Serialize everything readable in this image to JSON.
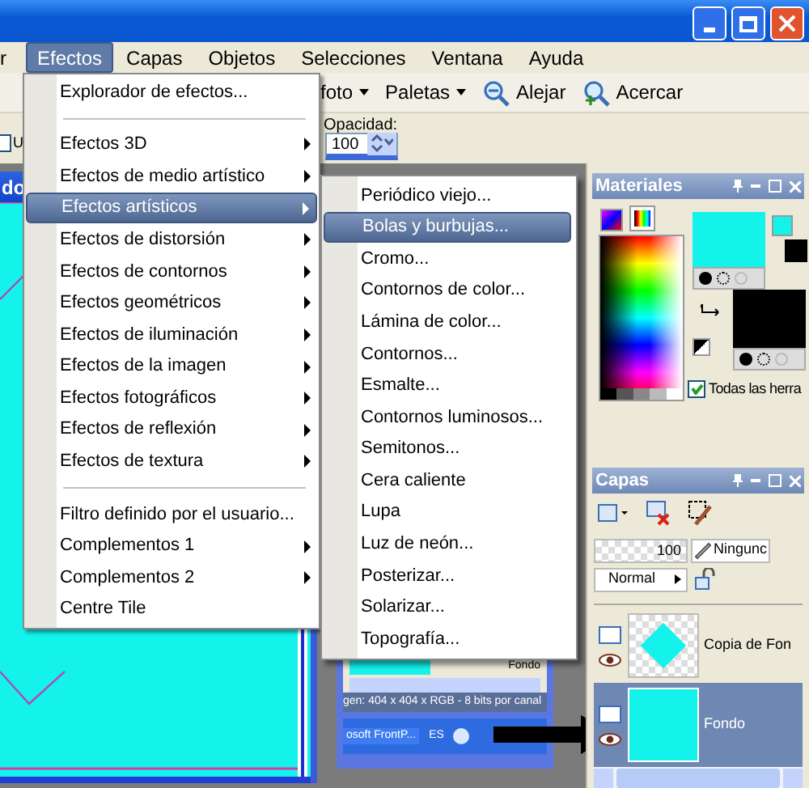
{
  "menu_bar": [
    {
      "label": "r",
      "selected": false
    },
    {
      "label": "Efectos",
      "selected": true
    },
    {
      "label": "Capas",
      "selected": false
    },
    {
      "label": "Objetos",
      "selected": false
    },
    {
      "label": "Selecciones",
      "selected": false
    },
    {
      "label": "Ventana",
      "selected": false
    },
    {
      "label": "Ayuda",
      "selected": false
    }
  ],
  "toolbar": [
    {
      "label": "foto",
      "kind": "dropdown"
    },
    {
      "label": "Paletas",
      "kind": "dropdown"
    },
    {
      "label": "Alejar",
      "kind": "zoom-out"
    },
    {
      "label": "Acercar",
      "kind": "zoom-in"
    }
  ],
  "options_bar": {
    "checkbox_label": "U",
    "checked": false,
    "opacity_label": "Opacidad:",
    "opacity_value": "100"
  },
  "document_window": {
    "title": "do"
  },
  "effects_menu": [
    {
      "kind": "item",
      "label": "Explorador de efectos...",
      "submenu": false,
      "selected": false
    },
    {
      "kind": "separator"
    },
    {
      "kind": "item",
      "label": "Efectos 3D",
      "submenu": true,
      "selected": false
    },
    {
      "kind": "item",
      "label": "Efectos de medio artístico",
      "submenu": true,
      "selected": false
    },
    {
      "kind": "item",
      "label": "Efectos artísticos",
      "submenu": true,
      "selected": true
    },
    {
      "kind": "item",
      "label": "Efectos de distorsión",
      "submenu": true,
      "selected": false
    },
    {
      "kind": "item",
      "label": "Efectos de contornos",
      "submenu": true,
      "selected": false
    },
    {
      "kind": "item",
      "label": "Efectos geométricos",
      "submenu": true,
      "selected": false
    },
    {
      "kind": "item",
      "label": "Efectos de iluminación",
      "submenu": true,
      "selected": false
    },
    {
      "kind": "item",
      "label": "Efectos de la imagen",
      "submenu": true,
      "selected": false
    },
    {
      "kind": "item",
      "label": "Efectos fotográficos",
      "submenu": true,
      "selected": false
    },
    {
      "kind": "item",
      "label": "Efectos de reflexión",
      "submenu": true,
      "selected": false
    },
    {
      "kind": "item",
      "label": "Efectos de textura",
      "submenu": true,
      "selected": false
    },
    {
      "kind": "separator"
    },
    {
      "kind": "item",
      "label": "Filtro definido por el usuario...",
      "submenu": false,
      "selected": false
    },
    {
      "kind": "item",
      "label": "Complementos 1",
      "submenu": true,
      "selected": false
    },
    {
      "kind": "item",
      "label": "Complementos 2",
      "submenu": true,
      "selected": false
    },
    {
      "kind": "item",
      "label": "Centre Tile",
      "submenu": false,
      "selected": false
    }
  ],
  "artistic_submenu": [
    {
      "label": "Periódico viejo...",
      "selected": false
    },
    {
      "label": "Bolas y burbujas...",
      "selected": true
    },
    {
      "label": "Cromo...",
      "selected": false
    },
    {
      "label": "Contornos de color...",
      "selected": false
    },
    {
      "label": "Lámina de color...",
      "selected": false
    },
    {
      "label": "Contornos...",
      "selected": false
    },
    {
      "label": "Esmalte...",
      "selected": false
    },
    {
      "label": "Contornos luminosos...",
      "selected": false
    },
    {
      "label": "Semitonos...",
      "selected": false
    },
    {
      "label": "Cera caliente",
      "selected": false
    },
    {
      "label": "Lupa",
      "selected": false
    },
    {
      "label": "Luz de neón...",
      "selected": false
    },
    {
      "label": "Posterizar...",
      "selected": false
    },
    {
      "label": "Solarizar...",
      "selected": false
    },
    {
      "label": "Topografía...",
      "selected": false
    }
  ],
  "materials_panel": {
    "title": "Materiales",
    "checkbox_label": "Todas las herra",
    "checked": true
  },
  "layers_panel": {
    "title": "Capas",
    "opacity": "100",
    "mask": "Ningunc",
    "blend_mode": "Normal",
    "layers": [
      {
        "name": "Copia de Fon",
        "selected": false
      },
      {
        "name": "Fondo",
        "selected": true
      }
    ]
  },
  "background_window": {
    "layer_name": "Fondo",
    "status": "gen: 404 x 404 x RGB - 8 bits por canal",
    "taskbar_item": "osoft FrontP...",
    "language": "ES"
  }
}
